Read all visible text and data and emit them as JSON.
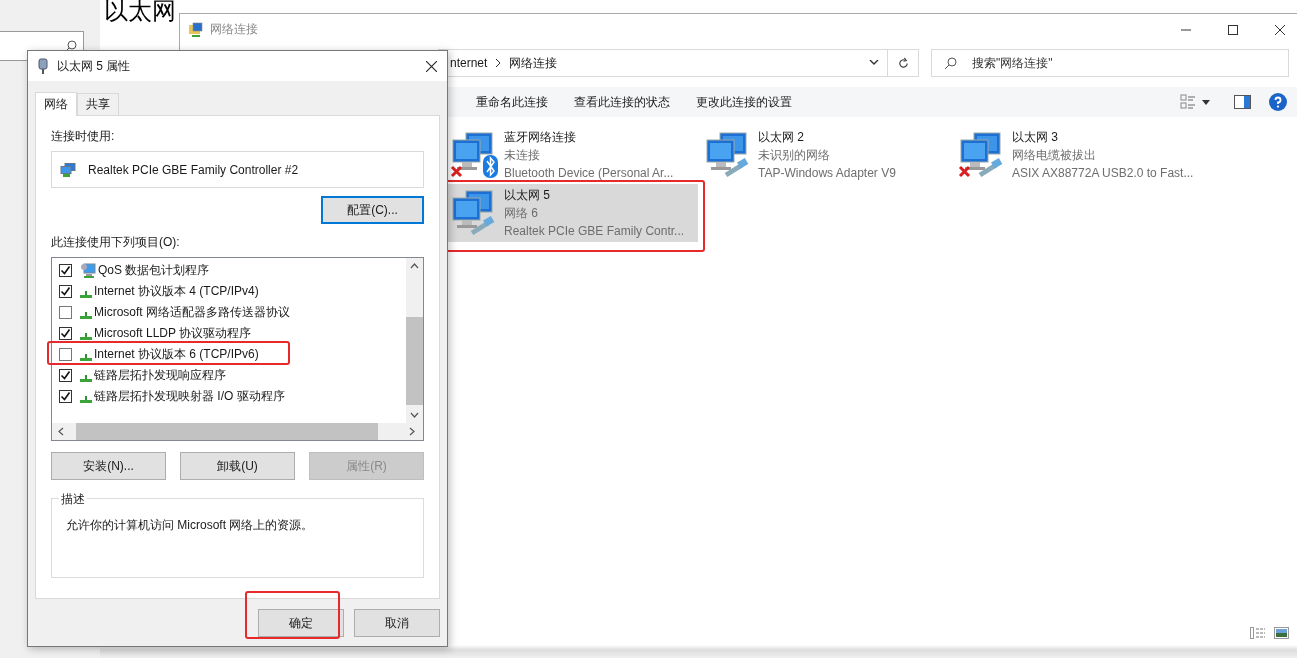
{
  "background": {
    "heading": "以太网"
  },
  "explorer": {
    "title": "网络连接",
    "address": [
      "nternet",
      "网络连接"
    ],
    "search_placeholder": "搜索\"网络连接\"",
    "toolbar": [
      "重命名此连接",
      "查看此连接的状态",
      "更改此连接的设置"
    ],
    "connections": [
      {
        "name": "蓝牙网络连接",
        "status": "未连接",
        "device": "Bluetooth Device (Personal Ar...",
        "kind": "bluetooth",
        "error": true,
        "selected": false
      },
      {
        "name": "以太网 2",
        "status": "未识别的网络",
        "device": "TAP-Windows Adapter V9",
        "kind": "ethernet",
        "error": false,
        "selected": false
      },
      {
        "name": "以太网 3",
        "status": "网络电缆被拔出",
        "device": "ASIX AX88772A USB2.0 to Fast...",
        "kind": "ethernet",
        "error": true,
        "selected": false
      },
      {
        "name": "以太网 5",
        "status": "网络 6",
        "device": "Realtek PCIe GBE Family Contr...",
        "kind": "ethernet",
        "error": false,
        "selected": true
      }
    ]
  },
  "dialog": {
    "title": "以太网 5 属性",
    "tabs": [
      {
        "label": "网络",
        "selected": true
      },
      {
        "label": "共享",
        "selected": false
      }
    ],
    "connect_using_label": "连接时使用:",
    "adapter": "Realtek PCIe GBE Family Controller #2",
    "configure_button": "配置(C)...",
    "items_label": "此连接使用下列项目(O):",
    "items": [
      {
        "label": "QoS 数据包计划程序",
        "checked": true,
        "kind": "service"
      },
      {
        "label": "Internet 协议版本 4 (TCP/IPv4)",
        "checked": true,
        "kind": "protocol"
      },
      {
        "label": "Microsoft 网络适配器多路传送器协议",
        "checked": false,
        "kind": "protocol"
      },
      {
        "label": "Microsoft LLDP 协议驱动程序",
        "checked": true,
        "kind": "protocol"
      },
      {
        "label": "Internet 协议版本 6 (TCP/IPv6)",
        "checked": false,
        "kind": "protocol"
      },
      {
        "label": "链路层拓扑发现响应程序",
        "checked": true,
        "kind": "protocol"
      },
      {
        "label": "链路层拓扑发现映射器 I/O 驱动程序",
        "checked": true,
        "kind": "protocol"
      }
    ],
    "item_buttons": [
      {
        "label": "安装(N)...",
        "disabled": false
      },
      {
        "label": "卸载(U)",
        "disabled": false
      },
      {
        "label": "属性(R)",
        "disabled": true
      }
    ],
    "description_title": "描述",
    "description": "允许你的计算机访问 Microsoft 网络上的资源。",
    "buttons": [
      "确定",
      "取消"
    ]
  }
}
